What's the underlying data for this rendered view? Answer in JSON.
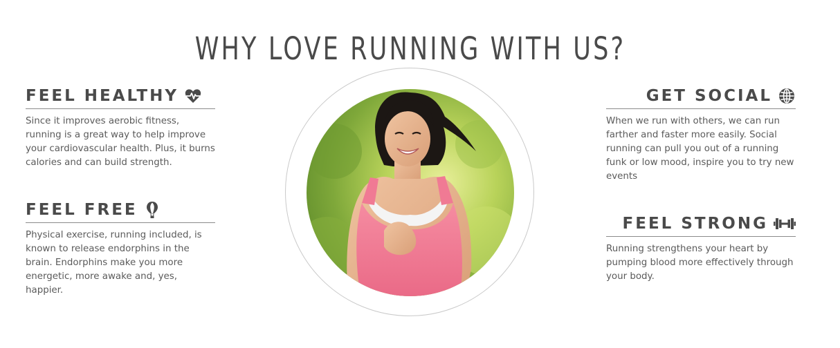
{
  "page": {
    "title": "WHY LOVE RUNNING WITH US?"
  },
  "features": {
    "healthy": {
      "title": "FEEL HEALTHY",
      "icon": "heartbeat-icon",
      "text": "Since it improves aerobic fitness, running is a great way to help improve your cardiovascular health. Plus, it burns calories and can build strength."
    },
    "free": {
      "title": "FEEL FREE",
      "icon": "hot-air-balloon-icon",
      "text": "Physical exercise, running included, is known to release endorphins in the brain. Endorphins make you more energetic, more awake and, yes, happier."
    },
    "social": {
      "title": "GET SOCIAL",
      "icon": "globe-icon",
      "text": "When we run with others, we can run farther and faster more easily. Social running can pull you out of a running funk or low mood, inspire you to try new events"
    },
    "strong": {
      "title": "FEEL STRONG",
      "icon": "dumbbell-icon",
      "text": "Running strengthens your heart by pumping blood more effectively through your body."
    }
  },
  "photo": {
    "subject": "runner-photo"
  },
  "colors": {
    "text": "#4a4a4a",
    "body_text": "#5a5a5a",
    "divider": "#8a8a8a",
    "ring": "#c9c9c9",
    "tank_top": "#f07a94"
  }
}
